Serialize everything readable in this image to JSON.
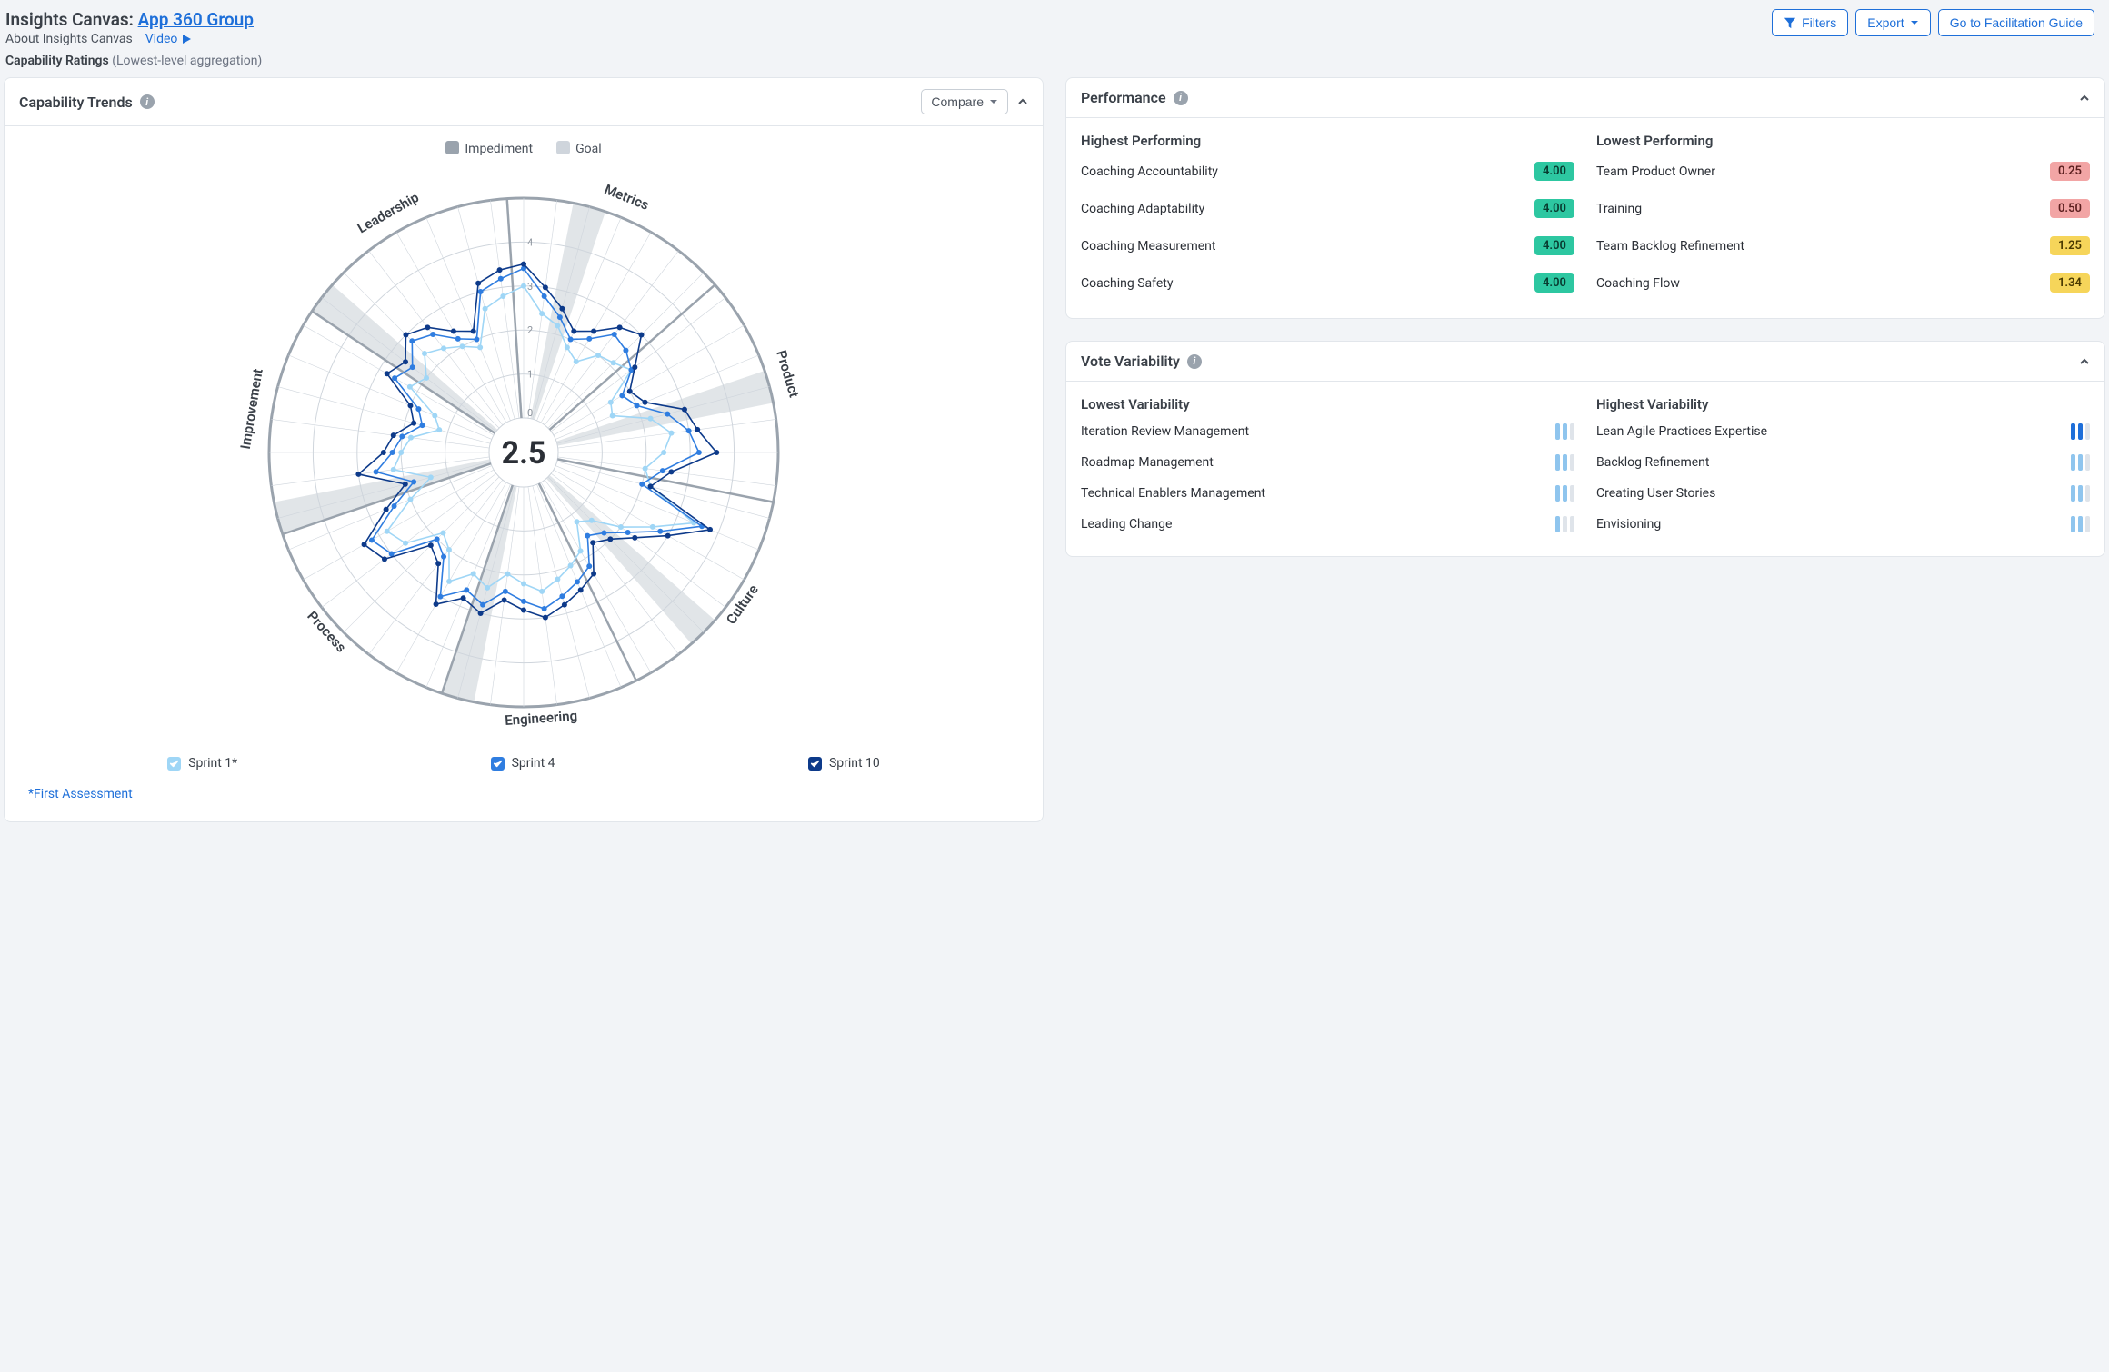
{
  "header": {
    "title_prefix": "Insights Canvas: ",
    "title_link": "App 360 Group",
    "about": "About Insights Canvas",
    "video": "Video",
    "subtitle_main": "Capability Ratings ",
    "subtitle_light": "(Lowest-level aggregation)",
    "buttons": {
      "filters": "Filters",
      "export": "Export",
      "guide": "Go to Facilitation Guide"
    }
  },
  "trends": {
    "title": "Capability Trends",
    "compare": "Compare",
    "legend": {
      "impediment": "Impediment",
      "goal": "Goal"
    },
    "center": "2.5",
    "sprints": [
      {
        "label": "Sprint 1*",
        "tone": "light"
      },
      {
        "label": "Sprint 4",
        "tone": "mid"
      },
      {
        "label": "Sprint 10",
        "tone": "dark"
      }
    ],
    "footnote": "*First Assessment",
    "axisCategories": [
      "Metrics",
      "Product",
      "Culture",
      "Engineering",
      "Process",
      "Improvement",
      "Leadership"
    ],
    "ticks": [
      "0",
      "1",
      "2",
      "3",
      "4"
    ]
  },
  "performance": {
    "title": "Performance",
    "cols": {
      "hi": "Highest Performing",
      "lo": "Lowest Performing"
    },
    "hi": [
      {
        "name": "Coaching Accountability",
        "v": "4.00"
      },
      {
        "name": "Coaching Adaptability",
        "v": "4.00"
      },
      {
        "name": "Coaching Measurement",
        "v": "4.00"
      },
      {
        "name": "Coaching Safety",
        "v": "4.00"
      }
    ],
    "lo": [
      {
        "name": "Team Product Owner",
        "v": "0.25",
        "c": "red"
      },
      {
        "name": "Training",
        "v": "0.50",
        "c": "red"
      },
      {
        "name": "Team Backlog Refinement",
        "v": "1.25",
        "c": "yellow"
      },
      {
        "name": "Coaching Flow",
        "v": "1.34",
        "c": "yellow"
      }
    ]
  },
  "variability": {
    "title": "Vote Variability",
    "cols": {
      "lo": "Lowest Variability",
      "hi": "Highest Variability"
    },
    "lo": [
      {
        "name": "Iteration Review Management",
        "pattern": "110"
      },
      {
        "name": "Roadmap Management",
        "pattern": "110"
      },
      {
        "name": "Technical Enablers Management",
        "pattern": "110"
      },
      {
        "name": "Leading Change",
        "pattern": "100"
      }
    ],
    "hi": [
      {
        "name": "Lean Agile Practices Expertise",
        "pattern": "220"
      },
      {
        "name": "Backlog Refinement",
        "pattern": "110"
      },
      {
        "name": "Creating User Stories",
        "pattern": "110"
      },
      {
        "name": "Envisioning",
        "pattern": "110"
      }
    ]
  },
  "chart_data": {
    "type": "radar",
    "title": "Capability Trends",
    "center_value": 2.5,
    "scale": {
      "min": 0,
      "max": 5,
      "ticks": [
        0,
        1,
        2,
        3,
        4
      ]
    },
    "categories": [
      "Metrics",
      "Product",
      "Culture",
      "Engineering",
      "Process",
      "Improvement",
      "Leadership"
    ],
    "spoke_count": 48,
    "series": [
      {
        "name": "Sprint 1*",
        "color": "#9fd6f6",
        "values": [
          3.0,
          2.4,
          2.2,
          1.8,
          1.6,
          2.0,
          2.1,
          2.3,
          1.5,
          1.4,
          2.2,
          2.6,
          2.4,
          2.0,
          2.2,
          3.4,
          2.6,
          2.0,
          1.4,
          1.2,
          1.8,
          2.0,
          2.2,
          2.4,
          2.2,
          2.0,
          2.4,
          2.2,
          2.6,
          2.0,
          1.8,
          2.6,
          2.8,
          2.0,
          1.4,
          2.2,
          2.0,
          1.8,
          1.2,
          1.4,
          2.2,
          2.0,
          2.4,
          2.2,
          2.0,
          1.8,
          2.6,
          2.8
        ]
      },
      {
        "name": "Sprint 4",
        "color": "#2f7de0",
        "values": [
          3.4,
          2.8,
          2.4,
          2.0,
          2.2,
          2.6,
          2.5,
          2.3,
          1.8,
          2.0,
          2.6,
          3.0,
          3.2,
          2.4,
          2.0,
          3.6,
          2.8,
          2.2,
          1.8,
          1.6,
          2.2,
          2.4,
          2.6,
          2.8,
          2.6,
          2.4,
          2.8,
          2.6,
          3.0,
          2.2,
          2.0,
          3.0,
          3.2,
          2.4,
          1.8,
          2.6,
          2.2,
          2.0,
          1.6,
          1.8,
          2.6,
          2.4,
          2.8,
          2.6,
          2.2,
          2.0,
          3.0,
          3.2
        ]
      },
      {
        "name": "Sprint 10",
        "color": "#0d3a8a",
        "values": [
          3.5,
          3.0,
          2.6,
          2.2,
          2.4,
          2.8,
          3.0,
          2.4,
          2.0,
          2.2,
          3.0,
          3.2,
          3.6,
          2.6,
          2.2,
          3.8,
          3.0,
          2.4,
          2.0,
          1.8,
          2.4,
          2.6,
          2.8,
          3.0,
          2.8,
          2.6,
          3.0,
          2.8,
          3.2,
          2.4,
          2.2,
          3.2,
          3.4,
          2.6,
          2.0,
          3.0,
          2.4,
          2.2,
          1.8,
          2.0,
          2.8,
          2.6,
          3.0,
          2.8,
          2.4,
          2.2,
          3.2,
          3.4
        ]
      }
    ],
    "wedges_highlighted": [
      2,
      10,
      18,
      26,
      34,
      41
    ]
  }
}
